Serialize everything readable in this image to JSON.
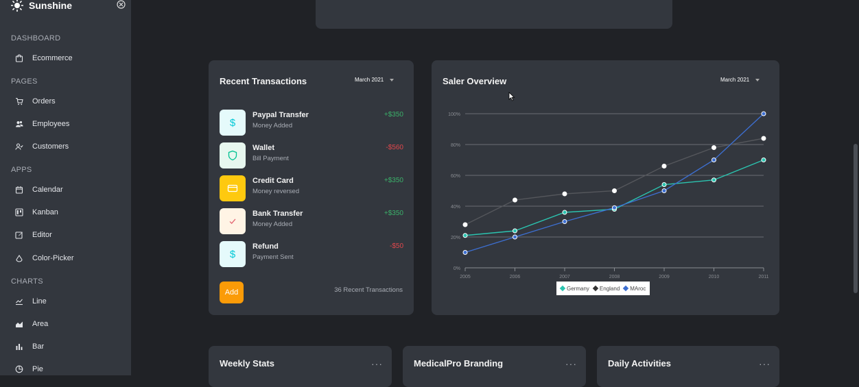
{
  "app": {
    "name": "Sunshine"
  },
  "sidebar": {
    "sections": [
      {
        "title": "DASHBOARD",
        "items": [
          {
            "label": "Ecommerce",
            "icon": "shopping-bag-icon"
          }
        ]
      },
      {
        "title": "PAGES",
        "items": [
          {
            "label": "Orders",
            "icon": "cart-icon"
          },
          {
            "label": "Employees",
            "icon": "users-icon"
          },
          {
            "label": "Customers",
            "icon": "user-group-icon"
          }
        ]
      },
      {
        "title": "APPS",
        "items": [
          {
            "label": "Calendar",
            "icon": "calendar-icon"
          },
          {
            "label": "Kanban",
            "icon": "kanban-icon"
          },
          {
            "label": "Editor",
            "icon": "edit-icon"
          },
          {
            "label": "Color-Picker",
            "icon": "color-picker-icon"
          }
        ]
      },
      {
        "title": "CHARTS",
        "items": [
          {
            "label": "Line",
            "icon": "line-chart-icon"
          },
          {
            "label": "Area",
            "icon": "area-chart-icon"
          },
          {
            "label": "Bar",
            "icon": "bar-chart-icon"
          },
          {
            "label": "Pie",
            "icon": "pie-chart-icon"
          }
        ]
      }
    ]
  },
  "transactions": {
    "title": "Recent Transactions",
    "month": "March 2021",
    "items": [
      {
        "name": "Paypal Transfer",
        "sub": "Money Added",
        "amount": "+$350",
        "type": "pos",
        "icon": "dollar-icon",
        "icon_bg": "#e5fafb",
        "icon_color": "#03c9d7"
      },
      {
        "name": "Wallet",
        "sub": "Bill Payment",
        "amount": "-$560",
        "type": "neg",
        "icon": "shield-icon",
        "icon_bg": "#e7f7ef",
        "icon_color": "#00c292"
      },
      {
        "name": "Credit Card",
        "sub": "Money reversed",
        "amount": "+$350",
        "type": "pos",
        "icon": "credit-card-icon",
        "icon_bg": "#fec90f",
        "icon_color": "#ffffff"
      },
      {
        "name": "Bank Transfer",
        "sub": "Money Added",
        "amount": "+$350",
        "type": "pos",
        "icon": "check-icon",
        "icon_bg": "#fff4e5",
        "icon_color": "#e46a76"
      },
      {
        "name": "Refund",
        "sub": "Payment Sent",
        "amount": "-$50",
        "type": "neg",
        "icon": "dollar-icon",
        "icon_bg": "#e5fafb",
        "icon_color": "#03c9d7"
      }
    ],
    "add_label": "Add",
    "count_label": "36 Recent Transactions"
  },
  "overview": {
    "title": "Saler Overview",
    "month": "March 2021"
  },
  "chart_data": {
    "type": "line",
    "title": "Saler Overview",
    "x": [
      "2005",
      "2006",
      "2007",
      "2008",
      "2009",
      "2010",
      "2011"
    ],
    "y_ticks": [
      "0%",
      "20%",
      "40%",
      "60%",
      "80%",
      "100%"
    ],
    "ylim": [
      0,
      100
    ],
    "grid": true,
    "legend_position": "bottom",
    "series": [
      {
        "name": "Germany",
        "color": "#2bc4b0",
        "values": [
          21,
          24,
          36,
          38,
          54,
          57,
          70
        ]
      },
      {
        "name": "England",
        "color": "#ffffff",
        "line_color": "#55575c",
        "values": [
          28,
          44,
          48,
          50,
          66,
          78,
          84
        ]
      },
      {
        "name": "MAroc",
        "color": "#3d6fd1",
        "values": [
          10,
          20,
          30,
          39,
          50,
          70,
          100
        ]
      }
    ]
  },
  "bottom_cards": {
    "weekly": "Weekly Stats",
    "branding": "MedicalPro Branding",
    "daily": "Daily Activities",
    "menu_label": "···"
  }
}
